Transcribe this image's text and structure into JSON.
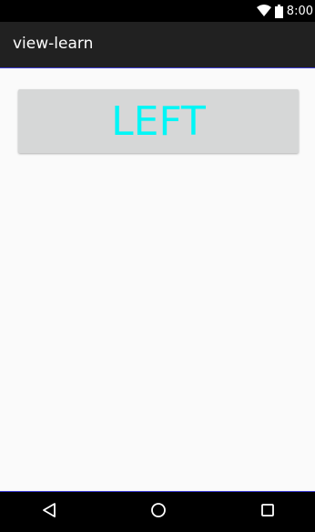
{
  "status_bar": {
    "time": "8:00",
    "icons": [
      "wifi-icon",
      "battery-icon"
    ]
  },
  "action_bar": {
    "title": "view-learn"
  },
  "main": {
    "button_label": "LEFT"
  },
  "nav_bar": {
    "icons": [
      "back-icon",
      "home-icon",
      "recents-icon"
    ]
  },
  "colors": {
    "status_bar": "#000000",
    "action_bar": "#212121",
    "background": "#fafafa",
    "button_bg": "#d6d7d7",
    "button_text": "#00f6f6",
    "nav_bar": "#000000"
  }
}
